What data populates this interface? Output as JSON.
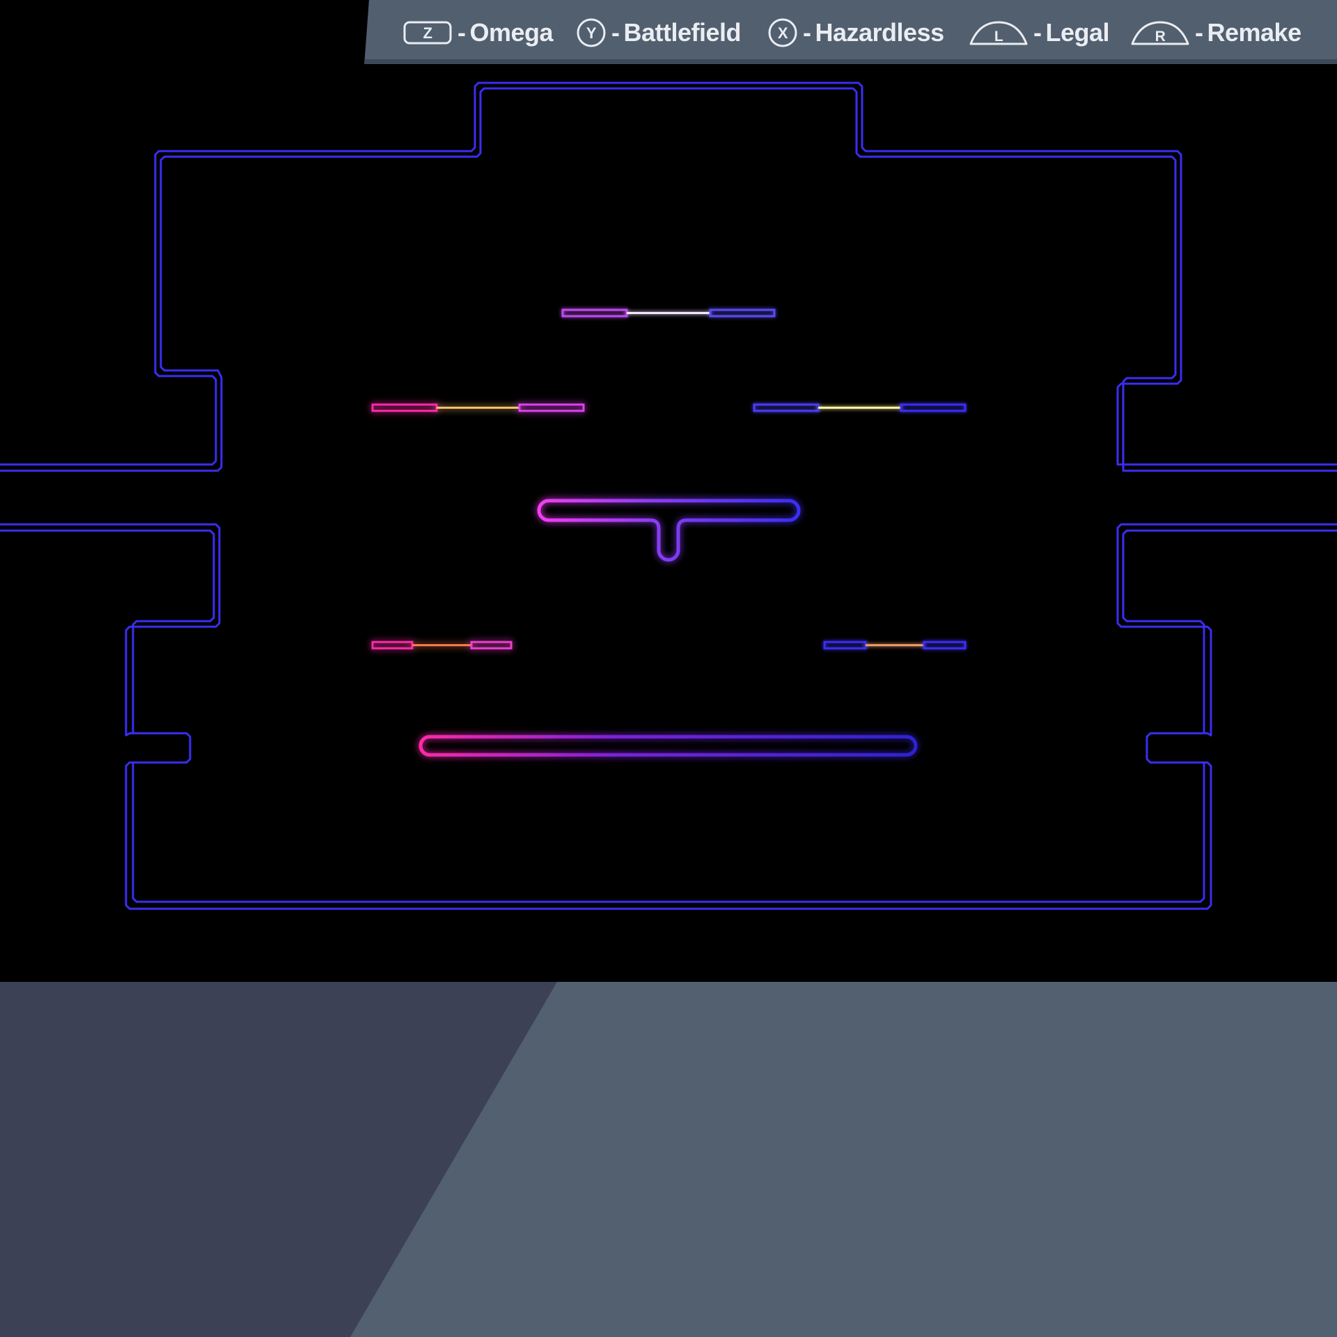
{
  "screen": {
    "name": "stage-select-form-preview",
    "colors": {
      "background": "#000000",
      "legend_bar": "#525f6f",
      "legend_bar_shadow": "#3f4a58",
      "panel_dark": "#3c4156",
      "panel_light": "#526070",
      "stage_outline": "#3a2ef2",
      "stage_glow_pink": "#ff2aa8",
      "stage_glow_violet": "#d43cf2",
      "legend_text": "#eaedf2"
    }
  },
  "legend": {
    "separator": "-",
    "items": [
      {
        "button": "Z",
        "shape": "rounded-rect",
        "label": "Omega"
      },
      {
        "button": "Y",
        "shape": "circle",
        "label": "Battlefield"
      },
      {
        "button": "X",
        "shape": "circle",
        "label": "Hazardless"
      },
      {
        "button": "L",
        "shape": "shoulder",
        "label": "Legal"
      },
      {
        "button": "R",
        "shape": "shoulder",
        "label": "Remake"
      }
    ]
  },
  "stage_preview": {
    "style": "neon-outline",
    "platforms": [
      "top-center",
      "upper-left",
      "upper-right",
      "center-t",
      "lower-left",
      "lower-right",
      "main-floor"
    ]
  }
}
